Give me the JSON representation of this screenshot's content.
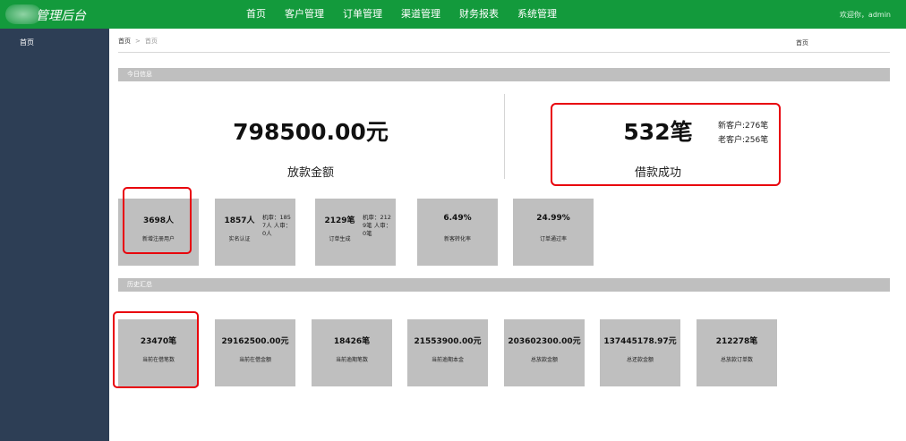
{
  "header": {
    "logo_text": "管理后台",
    "nav": [
      "首页",
      "客户管理",
      "订单管理",
      "渠道管理",
      "财务报表",
      "系统管理"
    ],
    "welcome": "欢迎你，admin"
  },
  "sidebar": {
    "items": [
      {
        "label": "首页"
      }
    ]
  },
  "breadcrumb": {
    "home": "首页",
    "sep": ">",
    "current": "首页"
  },
  "page_tag": "首页",
  "today": {
    "title": "今日信息",
    "amount": {
      "value": "798500.00元",
      "label": "放款金额"
    },
    "loans": {
      "value": "532笔",
      "label": "借款成功",
      "new_customers": "新客户:276笔",
      "old_customers": "老客户:256笔"
    },
    "cards": [
      {
        "value": "3698人",
        "label": "新增注册用户"
      },
      {
        "value": "1857人",
        "label": "实名认证",
        "detail": "机审：1857人 人审：0人"
      },
      {
        "value": "2129笔",
        "label": "订单生成",
        "detail": "机审：2129笔 人审：0笔"
      },
      {
        "value": "6.49%",
        "label": "新客转化率"
      },
      {
        "value": "24.99%",
        "label": "订单通过率"
      }
    ]
  },
  "history": {
    "title": "历史汇总",
    "cards": [
      {
        "value": "23470笔",
        "label": "当前在借笔数"
      },
      {
        "value": "29162500.00元",
        "label": "当前在借金额"
      },
      {
        "value": "18426笔",
        "label": "当前逾期笔数"
      },
      {
        "value": "21553900.00元",
        "label": "当前逾期本金"
      },
      {
        "value": "203602300.00元",
        "label": "总放款金额"
      },
      {
        "value": "137445178.97元",
        "label": "总还款金额"
      },
      {
        "value": "212278笔",
        "label": "总放款订单数"
      }
    ]
  },
  "colors": {
    "header_bg": "#139a3c",
    "sidebar_bg": "#2d3e55",
    "card_bg": "#bfbfbf",
    "section_bar": "#bfbfbf",
    "highlight": "#e8000b"
  }
}
